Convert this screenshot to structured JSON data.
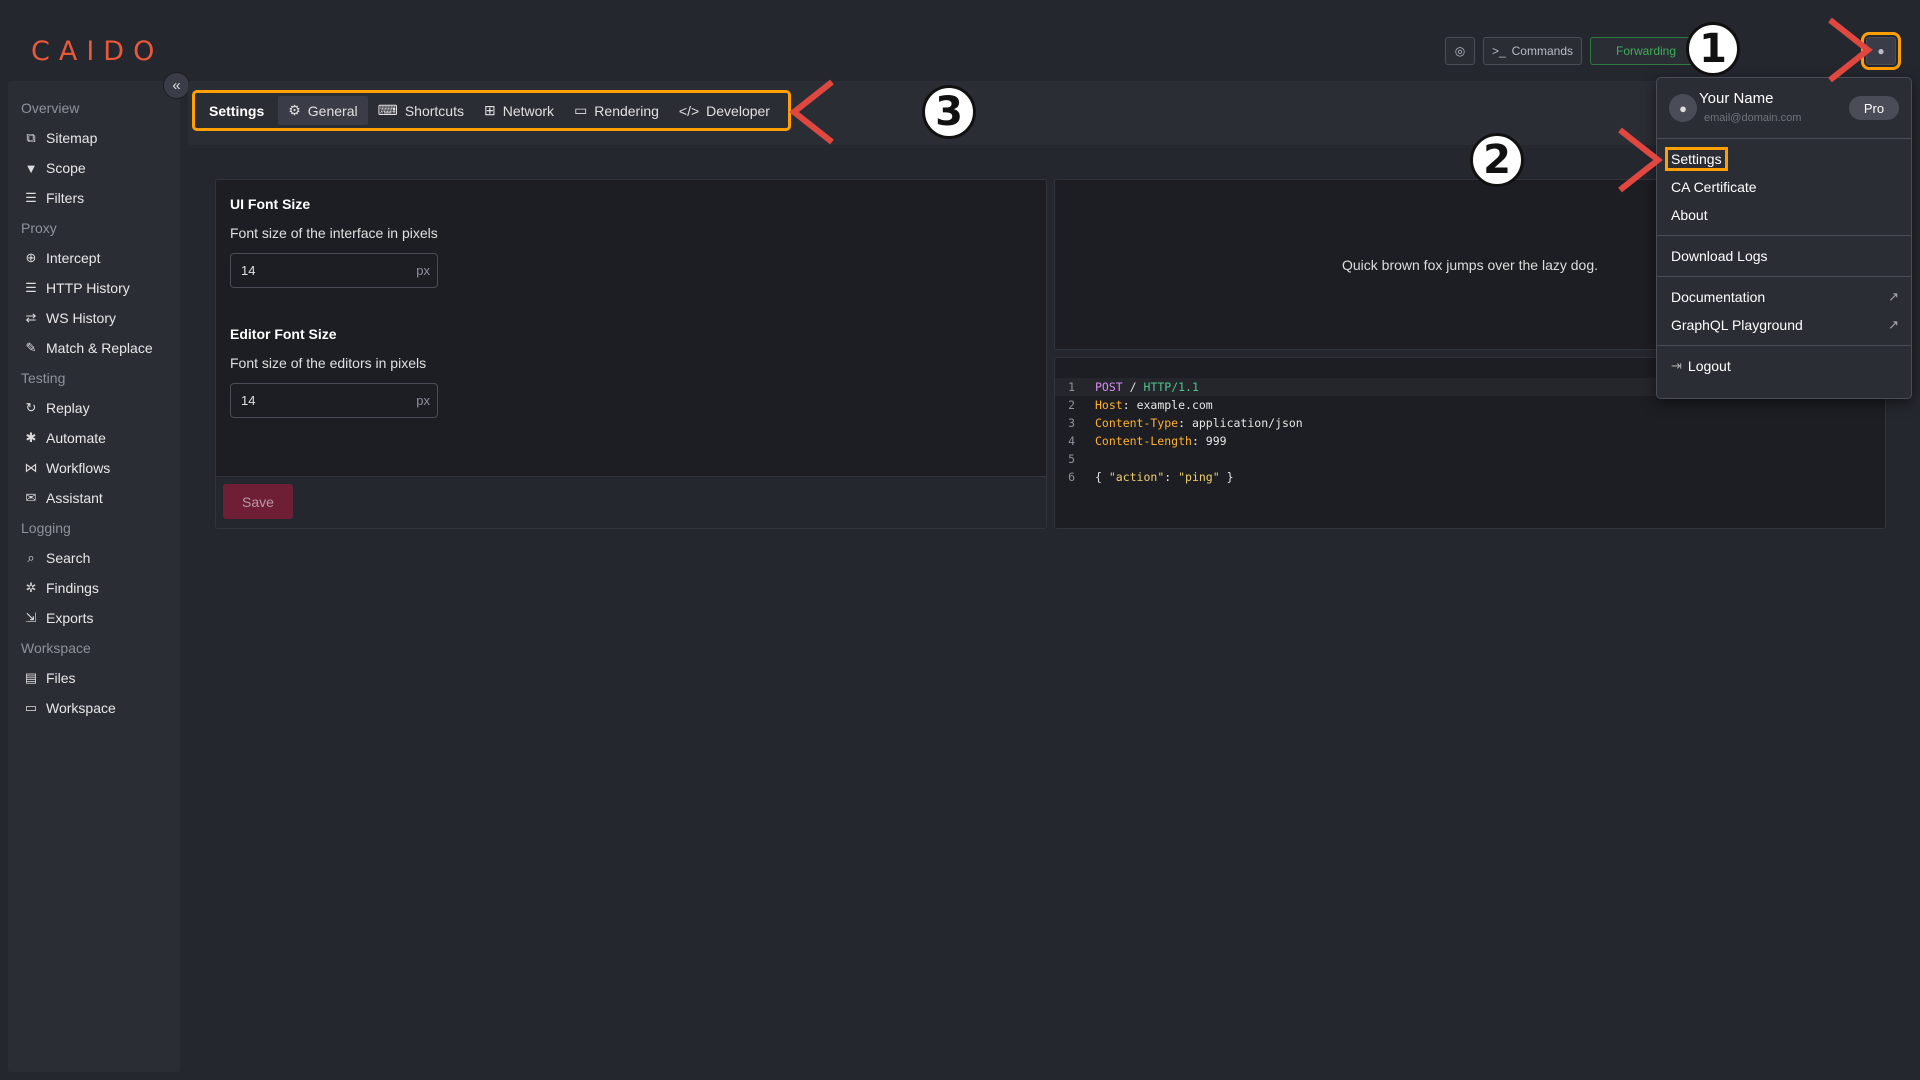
{
  "app": {
    "logo": "CAIDO"
  },
  "topbar": {
    "commands_label": "Commands",
    "forwarding_label": "Forwarding"
  },
  "sidebar": {
    "sections": [
      {
        "title": "Overview",
        "items": [
          {
            "label": "Sitemap",
            "icon": "sitemap-icon"
          },
          {
            "label": "Scope",
            "icon": "filter-icon"
          },
          {
            "label": "Filters",
            "icon": "sliders-icon"
          }
        ]
      },
      {
        "title": "Proxy",
        "items": [
          {
            "label": "Intercept",
            "icon": "crosshair-icon"
          },
          {
            "label": "HTTP History",
            "icon": "list-icon"
          },
          {
            "label": "WS History",
            "icon": "swap-icon"
          },
          {
            "label": "Match & Replace",
            "icon": "wrench-icon"
          }
        ]
      },
      {
        "title": "Testing",
        "items": [
          {
            "label": "Replay",
            "icon": "refresh-icon"
          },
          {
            "label": "Automate",
            "icon": "cog-icon"
          },
          {
            "label": "Workflows",
            "icon": "workflow-icon"
          },
          {
            "label": "Assistant",
            "icon": "chat-icon"
          }
        ]
      },
      {
        "title": "Logging",
        "items": [
          {
            "label": "Search",
            "icon": "search-icon"
          },
          {
            "label": "Findings",
            "icon": "bug-icon"
          },
          {
            "label": "Exports",
            "icon": "export-icon"
          }
        ]
      },
      {
        "title": "Workspace",
        "items": [
          {
            "label": "Files",
            "icon": "file-icon"
          },
          {
            "label": "Workspace",
            "icon": "monitor-icon"
          }
        ]
      }
    ]
  },
  "tabs": {
    "title": "Settings",
    "items": [
      {
        "label": "General",
        "icon": "gear-icon"
      },
      {
        "label": "Shortcuts",
        "icon": "keyboard-icon"
      },
      {
        "label": "Network",
        "icon": "network-icon"
      },
      {
        "label": "Rendering",
        "icon": "window-icon"
      },
      {
        "label": "Developer",
        "icon": "code-icon"
      }
    ]
  },
  "settings": {
    "ui_font": {
      "label": "UI Font Size",
      "desc": "Font size of the interface in pixels",
      "value": "14",
      "suffix": "px"
    },
    "editor_font": {
      "label": "Editor Font Size",
      "desc": "Font size of the editors in pixels",
      "value": "14",
      "suffix": "px"
    },
    "save_label": "Save"
  },
  "preview": {
    "text": "Quick brown fox jumps over the lazy dog.",
    "code_lines": [
      "1",
      "2",
      "3",
      "4",
      "5",
      "6"
    ]
  },
  "code": {
    "l1_method": "POST",
    "l1_path": "/",
    "l1_ver": "HTTP/1.1",
    "l2_key": "Host",
    "l2_val": "example.com",
    "l3_key": "Content-Type",
    "l3_val": "application/json",
    "l4_key": "Content-Length",
    "l4_val": "999",
    "l6_open": "{ ",
    "l6_key": "\"action\"",
    "l6_colon": ": ",
    "l6_val": "\"ping\"",
    "l6_close": " }"
  },
  "dropdown": {
    "name": "Your Name",
    "email": "email@domain.com",
    "plan": "Pro",
    "settings": "Settings",
    "ca_cert": "CA Certificate",
    "about": "About",
    "download_logs": "Download Logs",
    "documentation": "Documentation",
    "graphql": "GraphQL Playground",
    "logout": "Logout"
  },
  "annotations": {
    "n1": "1",
    "n2": "2",
    "n3": "3"
  },
  "colors": {
    "accent": "#ff9f00",
    "brand": "#e8583b",
    "forwarding": "#3fae5a",
    "arrow": "#e0473f"
  }
}
